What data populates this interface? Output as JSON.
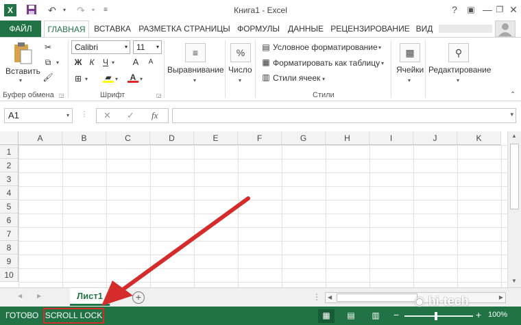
{
  "window": {
    "title": "Книга1 - Excel",
    "app_icon": "X",
    "min_glyph": "—",
    "restore_glyph": "❐",
    "close_glyph": "✕",
    "help_glyph": "?",
    "ribbon_opts_glyph": "▣"
  },
  "tabs": {
    "file": "ФАЙЛ",
    "home": "ГЛАВНАЯ",
    "insert": "ВСТАВКА",
    "layout": "РАЗМЕТКА СТРАНИЦЫ",
    "formulas": "ФОРМУЛЫ",
    "data": "ДАННЫЕ",
    "review": "РЕЦЕНЗИРОВАНИЕ",
    "view": "ВИД"
  },
  "ribbon": {
    "clipboard": {
      "paste": "Вставить",
      "label": "Буфер обмена"
    },
    "font": {
      "name": "Calibri",
      "size": "11",
      "bold": "Ж",
      "italic": "К",
      "underline": "Ч",
      "grow": "A",
      "shrink": "A",
      "label": "Шрифт"
    },
    "alignment": "Выравнивание",
    "number": "Число",
    "number_icon": "%",
    "styles": {
      "conditional": "Условное форматирование",
      "as_table": "Форматировать как таблицу",
      "cell_styles": "Стили ячеек",
      "label": "Стили"
    },
    "cells": "Ячейки",
    "editing": "Редактирование"
  },
  "formula_bar": {
    "name_box": "A1",
    "cancel": "✕",
    "enter": "✓",
    "fx": "fx",
    "value": ""
  },
  "grid": {
    "columns": [
      "A",
      "B",
      "C",
      "D",
      "E",
      "F",
      "G",
      "H",
      "I",
      "J",
      "K"
    ],
    "rows": [
      "1",
      "2",
      "3",
      "4",
      "5",
      "6",
      "7",
      "8",
      "9",
      "10"
    ]
  },
  "sheets": {
    "active": "Лист1",
    "add_glyph": "+"
  },
  "status": {
    "ready": "ГОТОВО",
    "scroll_lock": "SCROLL LOCK",
    "zoom": "100%",
    "zoom_minus": "−",
    "zoom_plus": "+"
  },
  "watermark": "hi-tech",
  "colors": {
    "accent": "#217346",
    "highlight": "#d42b2b"
  }
}
